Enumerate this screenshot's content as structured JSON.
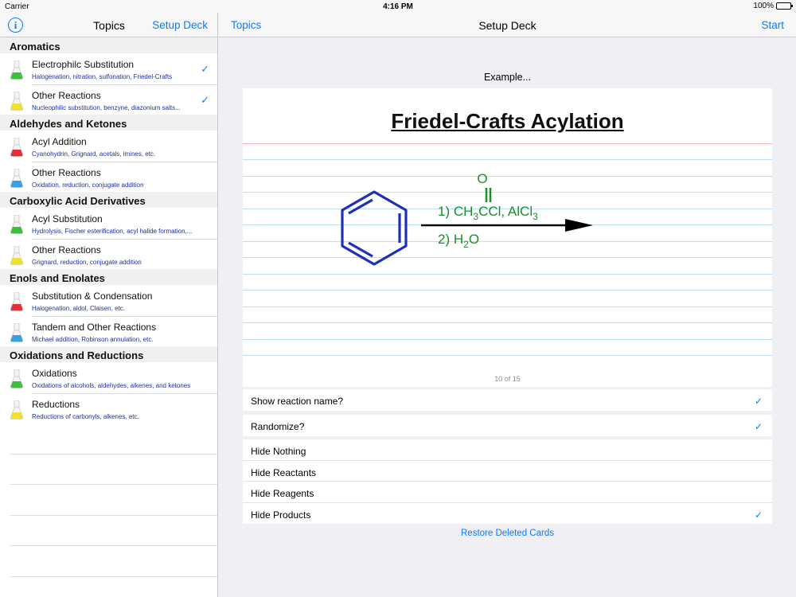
{
  "status_bar": {
    "carrier": "Carrier",
    "time": "4:16 PM",
    "battery": "100%"
  },
  "left_nav": {
    "info_icon": "info-icon",
    "title": "Topics",
    "action": "Setup Deck"
  },
  "sections": [
    {
      "title": "Aromatics",
      "rows": [
        {
          "title": "Electrophilc Substitution",
          "subtitle": "Halogenation, nitration, sulfonation, Friedel-Crafts",
          "checked": true,
          "flask_color": "#3fbf3f"
        },
        {
          "title": "Other Reactions",
          "subtitle": "Nucleophilic substitution, benzyne, diazonium salts...",
          "checked": true,
          "flask_color": "#f0e030"
        }
      ]
    },
    {
      "title": "Aldehydes and Ketones",
      "rows": [
        {
          "title": "Acyl Addition",
          "subtitle": "Cyanohydrin, Grignard, acetals, imines, etc.",
          "checked": false,
          "flask_color": "#e0303a"
        },
        {
          "title": "Other Reactions",
          "subtitle": "Oxidation, reduction, conjugate addition",
          "checked": false,
          "flask_color": "#3aa0e0"
        }
      ]
    },
    {
      "title": "Carboxylic Acid Derivatives",
      "rows": [
        {
          "title": "Acyl Substitution",
          "subtitle": "Hydrolysis, Fischer esterification, acyl halide formation,...",
          "checked": false,
          "flask_color": "#3fbf3f"
        },
        {
          "title": "Other Reactions",
          "subtitle": "Grignard, reduction, conjugate addition",
          "checked": false,
          "flask_color": "#f0e030"
        }
      ]
    },
    {
      "title": "Enols and Enolates",
      "rows": [
        {
          "title": "Substitution & Condensation",
          "subtitle": "Halogenation, aldol, Claisen, etc.",
          "checked": false,
          "flask_color": "#e0303a"
        },
        {
          "title": "Tandem and Other Reactions",
          "subtitle": "Michael addition, Robinson annulation, etc.",
          "checked": false,
          "flask_color": "#3aa0e0"
        }
      ]
    },
    {
      "title": "Oxidations and Reductions",
      "rows": [
        {
          "title": "Oxidations",
          "subtitle": "Oxidations of alcohols, aldehydes, alkenes, and ketones",
          "checked": false,
          "flask_color": "#3fbf3f"
        },
        {
          "title": "Reductions",
          "subtitle": "Reductions of carbonyls, alkenes, etc.",
          "checked": false,
          "flask_color": "#f0e030"
        }
      ]
    }
  ],
  "right_nav": {
    "back": "Topics",
    "title": "Setup Deck",
    "start": "Start"
  },
  "example_label": "Example...",
  "card": {
    "title": "Friedel-Crafts Acylation",
    "reagent_1_prefix": "1) CH",
    "reagent_1_sub1": "3",
    "reagent_1_mid": "CCl, AlCl",
    "reagent_1_sub2": "3",
    "carbonyl_o": "O",
    "reagent_2_prefix": "2) H",
    "reagent_2_sub": "2",
    "reagent_2_suffix": "O",
    "counter": "10 of 15"
  },
  "options_group1": [
    {
      "label": "Show reaction name?",
      "checked": true
    }
  ],
  "options_group2": [
    {
      "label": "Randomize?",
      "checked": true
    }
  ],
  "options_group3": [
    {
      "label": "Hide Nothing",
      "checked": false
    },
    {
      "label": "Hide Reactants",
      "checked": false
    },
    {
      "label": "Hide Reagents",
      "checked": false
    },
    {
      "label": "Hide Products",
      "checked": true
    }
  ],
  "restore_label": "Restore Deleted Cards",
  "icons": {
    "checkmark": "checkmark-icon",
    "flask": "flask-icon"
  }
}
